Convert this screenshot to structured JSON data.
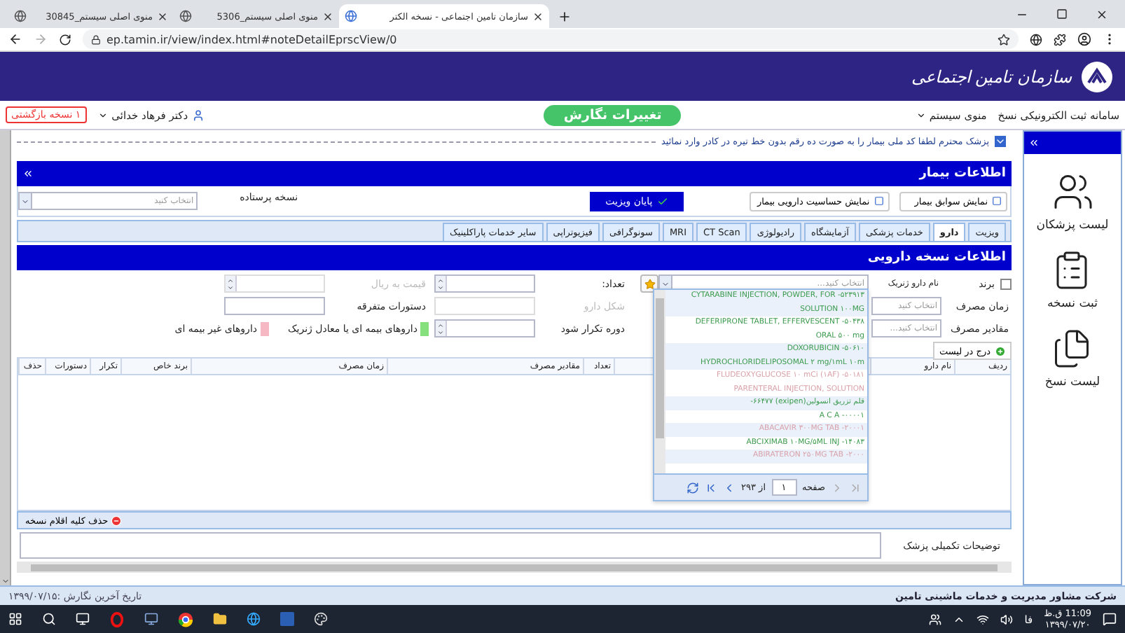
{
  "browser": {
    "tabs": [
      {
        "title": "سازمان تامین اجتماعی - نسخه الکتر",
        "selected": true
      },
      {
        "title": "منوی اصلی سیستم_5306",
        "selected": false
      },
      {
        "title": "منوی اصلی سیستم_30845",
        "selected": false
      }
    ],
    "url": "ep.tamin.ir/view/index.html#noteDetailEprscView/0"
  },
  "header": {
    "org_name": "سازمان تامین اجتماعی"
  },
  "nav": {
    "system_title": "سامانه ثبت الکترونیکی نسخ",
    "menu": "منوی سیستم",
    "changes_button": "تغییرات نگارش",
    "user": "دکتر فرهاد خدائی",
    "returned_button": "۱ نسخه بازگشتی"
  },
  "notice": "پزشک محترم لطفا کد ملی بیمار را به صورت ده رقم بدون خط تیره در کادر وارد نمائید",
  "patient": {
    "title": "اطلاعات بیمار",
    "history_button": "نمایش سوابق بیمار",
    "allergy_button": "نمایش حساسیت دارویی بیمار",
    "end_visit_button": "پایان ویزیت",
    "template_label": "نسخه پرستاده",
    "template_placeholder": "انتخاب کنید"
  },
  "service_tabs": [
    {
      "label": "ویزیت",
      "selected": false
    },
    {
      "label": "دارو",
      "selected": true
    },
    {
      "label": "خدمات پزشکی",
      "selected": false
    },
    {
      "label": "آزمایشگاه",
      "selected": false
    },
    {
      "label": "رادیولوژی",
      "selected": false
    },
    {
      "label": "CT Scan",
      "selected": false
    },
    {
      "label": "MRI",
      "selected": false
    },
    {
      "label": "سونوگرافی",
      "selected": false
    },
    {
      "label": "فیزیوتراپی",
      "selected": false
    },
    {
      "label": "سایر خدمات پاراکلینیک",
      "selected": false
    }
  ],
  "drug": {
    "title": "اطلاعات نسخه دارویی",
    "brand": {
      "label": "برند",
      "checked": false
    },
    "generic_label": "نام دارو ژنریک",
    "generic_placeholder": "انتخاب کنید...",
    "count_label": "تعداد:",
    "price": {
      "label": "قیمت به ریال",
      "disabled": true
    },
    "usage_time_label": "زمان مصرف",
    "usage_time_placeholder": "انتخاب کنید",
    "form": {
      "label": "شکل دارو",
      "disabled": true
    },
    "misc_label": "دستورات متفرقه",
    "dosage_label": "مقادیر مصرف",
    "dosage_placeholder": "انتخاب کنید...",
    "repeat_label": "دوره تکرار شود",
    "legend": [
      {
        "label": "داروهای بیمه ای یا معادل ژنریک",
        "color": "#86e07e"
      },
      {
        "label": "داروهای غیر بیمه ای",
        "color": "#f6b8c2"
      }
    ],
    "add_button": "درج در لیست"
  },
  "dropdown": {
    "items": [
      {
        "lines": [
          "CYTARABINE INJECTION, POWDER, FOR -۵۲۳۹۱۳",
          "SOLUTION ۱۰۰MG"
        ],
        "color": "#3a9a4c"
      },
      {
        "lines": [
          "DEFERIPRONE TABLET, EFFERVESCENT -۵۰۴۳۸",
          "ORAL ۵۰۰ mg"
        ],
        "color": "#3a9a4c"
      },
      {
        "lines": [
          "DOXORUBICIN -۵۰۶۱۰",
          "HYDROCHLORIDELIPOSOMAL ۲ mg/۱mL ۱۰m"
        ],
        "color": "#3a9a4c"
      },
      {
        "lines": [
          "FLUDEOXYGLUCOSE ۱۰ mCi (۱AF) -۵۰۱۸۱",
          "PARENTERAL INJECTION, SOLUTION"
        ],
        "color": "#d9a0a8"
      },
      {
        "lines": [
          "-۶۶۴۷۷ (exipen)قلم تزریق انسولین"
        ],
        "color": "#3a9a4c"
      },
      {
        "lines": [
          "A C A -۰۰۰۰۱"
        ],
        "color": "#3a9a4c"
      },
      {
        "lines": [
          "ABACAVIR ۳۰۰MG TAB -۲۰۰۰۱"
        ],
        "color": "#d9a0a8"
      },
      {
        "lines": [
          "ABCIXIMAB ۱۰MG/۵ML INJ -۱۴۰۸۳"
        ],
        "color": "#3a9a4c"
      },
      {
        "lines": [
          "ABIRATERON ۲۵۰MG TAB -۲۰۰۰"
        ],
        "color": "#d9a0a8"
      }
    ],
    "pager": {
      "page_label": "صفحه",
      "page": "۱",
      "of_label": "از ۲۹۳"
    }
  },
  "table": {
    "columns": [
      "ردیف",
      "نام دارو",
      "",
      "تعداد",
      "مقادیر مصرف",
      "زمان مصرف",
      "برند خاص",
      "تکرار",
      "دستورات",
      "حذف"
    ]
  },
  "delete_all_button": "حذف کلیه اقلام نسخه",
  "notes_label": "توضیحات تکمیلی پزشک",
  "sidebar": {
    "items": [
      {
        "label": "لیست پزشکان",
        "kind": "doctors"
      },
      {
        "label": "ثبت نسخه",
        "kind": "register"
      },
      {
        "label": "لیست نسخ",
        "kind": "list"
      }
    ]
  },
  "footer": {
    "company": "شرکت مشاور مدیریت و خدمات ماشینی تامین",
    "last_edit": "تاریخ آخرین نگارش :۱۳۹۹/۰۷/۱۵"
  },
  "taskbar": {
    "language": "فا",
    "time": "11:09 ق.ظ",
    "date": "۱۳۹۹/۰۷/۲۰"
  }
}
